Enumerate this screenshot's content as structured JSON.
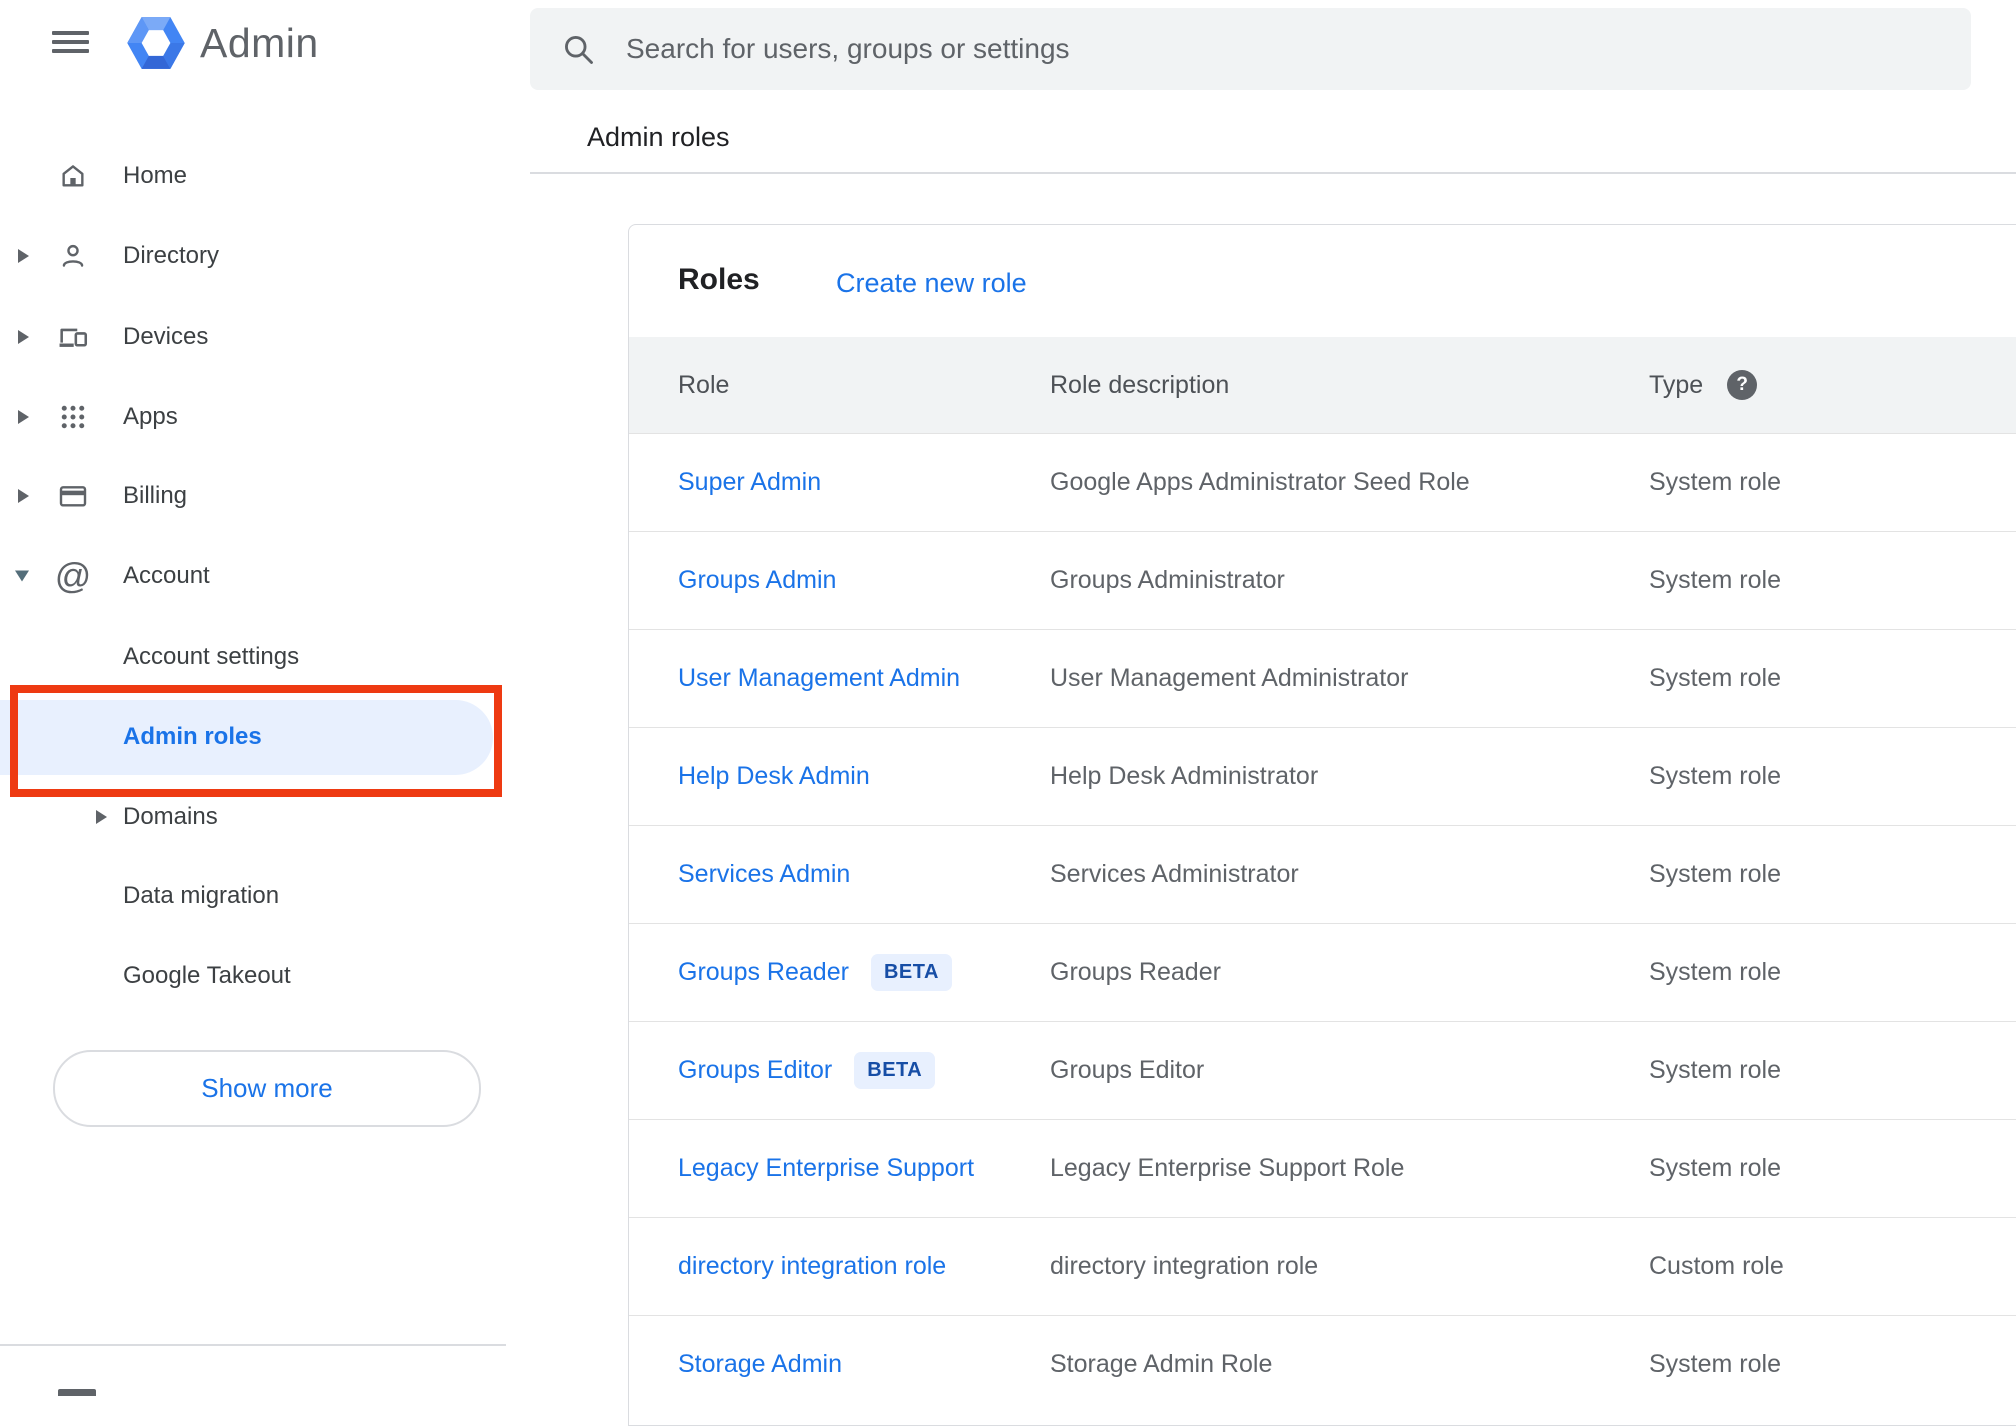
{
  "colors": {
    "accent_blue": "#1a73e8",
    "selected_bg": "#e8f0fe",
    "annotation_red": "#ee3a12",
    "logo_blue": "#4285f4",
    "gray_text": "#5f6368",
    "dark_text": "#202124",
    "header_bg": "#f1f3f4",
    "border": "#dadce0",
    "badge_bg": "#e8f0fe",
    "badge_text": "#174ea6"
  },
  "icons": [
    "menu-icon",
    "admin-logo-icon",
    "home-icon",
    "person-icon",
    "devices-icon",
    "apps-grid-icon",
    "credit-card-icon",
    "at-sign-icon",
    "chevron-right-icon",
    "chevron-down-icon",
    "search-icon",
    "help-icon"
  ],
  "sidebar": {
    "app_title": "Admin",
    "items": [
      {
        "label": "Home"
      },
      {
        "label": "Directory"
      },
      {
        "label": "Devices"
      },
      {
        "label": "Apps"
      },
      {
        "label": "Billing"
      },
      {
        "label": "Account"
      },
      {
        "label": "Account settings"
      },
      {
        "label": "Admin roles"
      },
      {
        "label": "Domains"
      },
      {
        "label": "Data migration"
      },
      {
        "label": "Google Takeout"
      }
    ],
    "show_more_label": "Show more"
  },
  "search": {
    "placeholder": "Search for users, groups or settings"
  },
  "breadcrumb": "Admin roles",
  "content": {
    "card_title": "Roles",
    "create_link": "Create new role",
    "table": {
      "headers": [
        "Role",
        "Role description",
        "Type"
      ],
      "rows": [
        {
          "role": "Super Admin",
          "description": "Google Apps Administrator Seed Role",
          "type": "System role"
        },
        {
          "role": "Groups Admin",
          "description": "Groups Administrator",
          "type": "System role"
        },
        {
          "role": "User Management Admin",
          "description": "User Management Administrator",
          "type": "System role"
        },
        {
          "role": "Help Desk Admin",
          "description": "Help Desk Administrator",
          "type": "System role"
        },
        {
          "role": "Services Admin",
          "description": "Services Administrator",
          "type": "System role"
        },
        {
          "role": "Groups Reader",
          "badge": "BETA",
          "description": "Groups Reader",
          "type": "System role"
        },
        {
          "role": "Groups Editor",
          "badge": "BETA",
          "description": "Groups Editor",
          "type": "System role"
        },
        {
          "role": "Legacy Enterprise Support",
          "description": "Legacy Enterprise Support Role",
          "type": "System role"
        },
        {
          "role": "directory integration role",
          "description": "directory integration role",
          "type": "Custom role"
        },
        {
          "role": "Storage Admin",
          "description": "Storage Admin Role",
          "type": "System role"
        }
      ]
    }
  },
  "annotation": {
    "target": "Admin roles sidebar item"
  }
}
